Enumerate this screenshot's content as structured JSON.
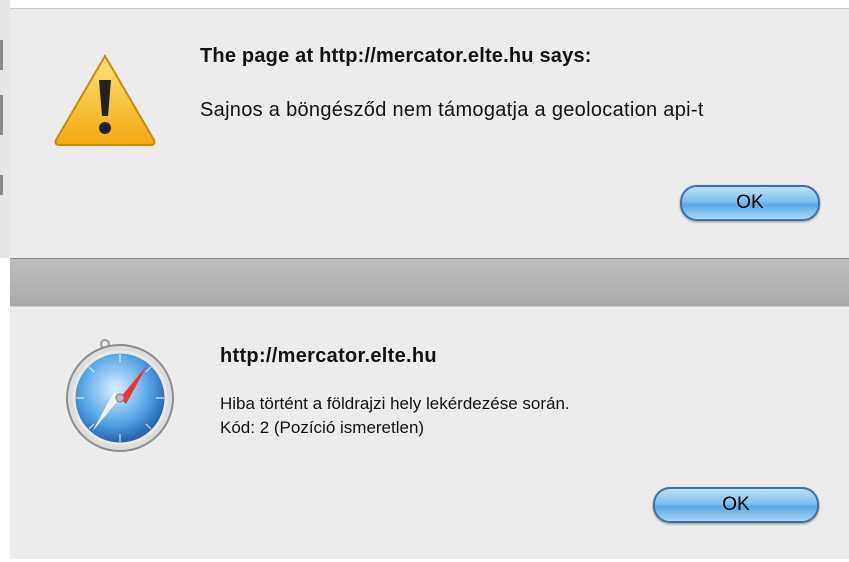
{
  "dialog_top": {
    "title": "The page at http://mercator.elte.hu says:",
    "message": "Sajnos a böngésződ nem támogatja a geolocation api-t",
    "ok_label": "OK",
    "icon": "warning-triangle-icon"
  },
  "dialog_bottom": {
    "title": "http://mercator.elte.hu",
    "message_line1": "Hiba történt a földrajzi hely lekérdezése során.",
    "message_line2": "Kód: 2 (Pozíció ismeretlen)",
    "ok_label": "OK",
    "icon": "safari-compass-icon"
  },
  "colors": {
    "dialog_bg": "#ececec",
    "button_blue": "#5aa8e8",
    "warning_yellow": "#f7c11c"
  }
}
